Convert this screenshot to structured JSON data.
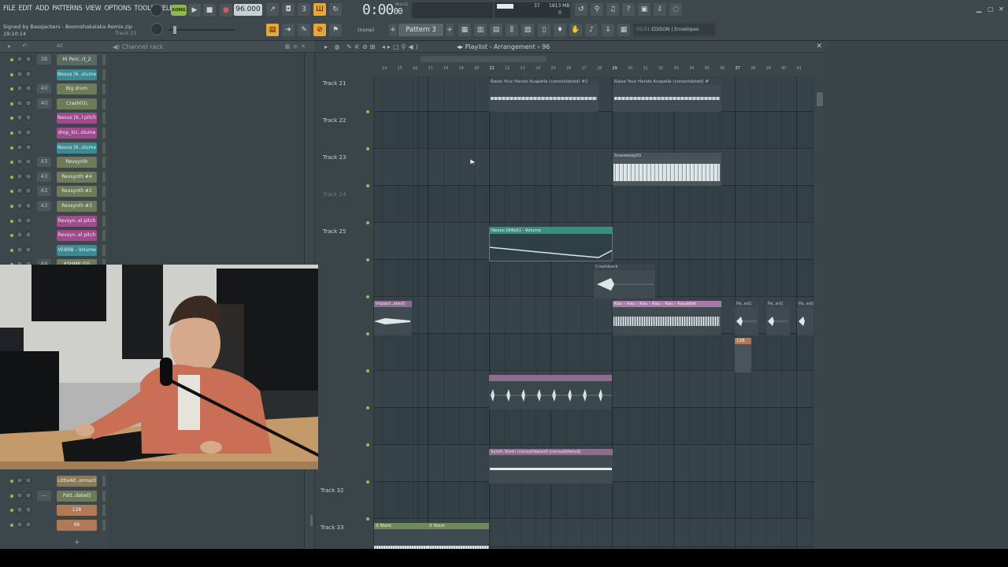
{
  "menu": [
    "FILE",
    "EDIT",
    "ADD",
    "PATTERNS",
    "VIEW",
    "OPTIONS",
    "TOOLS",
    "HELP"
  ],
  "song_info": {
    "title": "Signed by Bassjackers - Boomshakalaka Remix.zip",
    "time": "19:10:14",
    "track": "Track 23"
  },
  "transport": {
    "song_label": "SONG",
    "tempo": "96.000",
    "time_main": "0:00",
    "time_sub": "00",
    "mst_label": "M:S:CS"
  },
  "system": {
    "cpu": "37",
    "memory": "1813 MB",
    "mem_sub": "0"
  },
  "pattern": {
    "none": "(none)",
    "name": "Pattern 3"
  },
  "hint": {
    "num": "05/31",
    "text": "EDISON | Envelopes"
  },
  "channel_rack": {
    "title": "Channel rack",
    "filter": "All",
    "channels": [
      {
        "num": "36",
        "name": "Hi Perc..rt_2",
        "color": "#5a6a5e"
      },
      {
        "num": "",
        "name": "Nexus [6..olume",
        "color": "#3c8a93"
      },
      {
        "num": "40",
        "name": "Big drum",
        "color": "#6e7a58"
      },
      {
        "num": "40",
        "name": "Crash01\\",
        "color": "#6e7a58"
      },
      {
        "num": "",
        "name": "Nexus [6..l pitch",
        "color": "#a14a8e"
      },
      {
        "num": "",
        "name": "drop_kic..olume",
        "color": "#a14a8e"
      },
      {
        "num": "",
        "name": "Nexus [6..olume",
        "color": "#3c8a93"
      },
      {
        "num": "43",
        "name": "Revsynth",
        "color": "#6e7a58"
      },
      {
        "num": "43",
        "name": "Revsynth #4",
        "color": "#6e7a58"
      },
      {
        "num": "43",
        "name": "Revsynth #2",
        "color": "#6e7a58"
      },
      {
        "num": "43",
        "name": "Revsynth #3",
        "color": "#6e7a58"
      },
      {
        "num": "",
        "name": "Revsyn..el pitch",
        "color": "#a14a8e"
      },
      {
        "num": "",
        "name": "Revsyn..el pitch",
        "color": "#a14a8e"
      },
      {
        "num": "",
        "name": "VEBRB - Volume",
        "color": "#3c8a93"
      },
      {
        "num": "44",
        "name": "KSHMR (D)",
        "color": "#6e7a58"
      }
    ],
    "bottom_channels": [
      {
        "num": "",
        "name": "LittleAlt..ormant",
        "color": "#8a7a58"
      },
      {
        "num": "—",
        "name": "Patt..dated]",
        "color": "#6e7a58"
      },
      {
        "num": "",
        "name": "128",
        "color": "#b07a55"
      },
      {
        "num": "",
        "name": "96",
        "color": "#b07a55"
      }
    ]
  },
  "playlist": {
    "title": "Playlist - Arrangement",
    "pattern_num": "96",
    "ruler": [
      "14",
      "15",
      "16",
      "17",
      "18",
      "19",
      "20",
      "21",
      "22",
      "23",
      "24",
      "25",
      "26",
      "27",
      "28",
      "29",
      "30",
      "31",
      "32",
      "33",
      "34",
      "35",
      "36",
      "37",
      "38",
      "39",
      "40",
      "41"
    ],
    "tracks": [
      {
        "label": "Track 21",
        "dim": false
      },
      {
        "label": "Track 22",
        "dim": false
      },
      {
        "label": "Track 23",
        "dim": false
      },
      {
        "label": "Track 24",
        "dim": true
      },
      {
        "label": "Track 25",
        "dim": false
      },
      {
        "label": "",
        "dim": false
      },
      {
        "label": "",
        "dim": false
      },
      {
        "label": "",
        "dim": false
      },
      {
        "label": "",
        "dim": false
      },
      {
        "label": "",
        "dim": false
      },
      {
        "label": "",
        "dim": false
      },
      {
        "label": "Track 32",
        "dim": false
      },
      {
        "label": "Track 33",
        "dim": false
      }
    ],
    "clips": {
      "raise1": "Raise Your Hands Acapella (consolidated) #2",
      "raise2": "Raise Your Hands Acapella (consolidated) #",
      "snareloop": "Snareloop01",
      "nexus_volume": "Nexus [64bit] - Volume",
      "crashback": "Crashback",
      "impact": "Impact..ated]",
      "kauwbel_a": "Kau",
      "kauwbel_b": "Kauwbel",
      "pa_ed": "Pa..ed]",
      "small_128": "128",
      "synth_stem": "Synth Stem (consolidated) [consolidated]",
      "xstem1": "X Stem",
      "xstem2": "X Stem"
    }
  },
  "colors": {
    "accent": "#8fc24e",
    "audio_clip": "#3f4b50",
    "automation": "#3f8a7c",
    "pink": "#c07aa8"
  }
}
